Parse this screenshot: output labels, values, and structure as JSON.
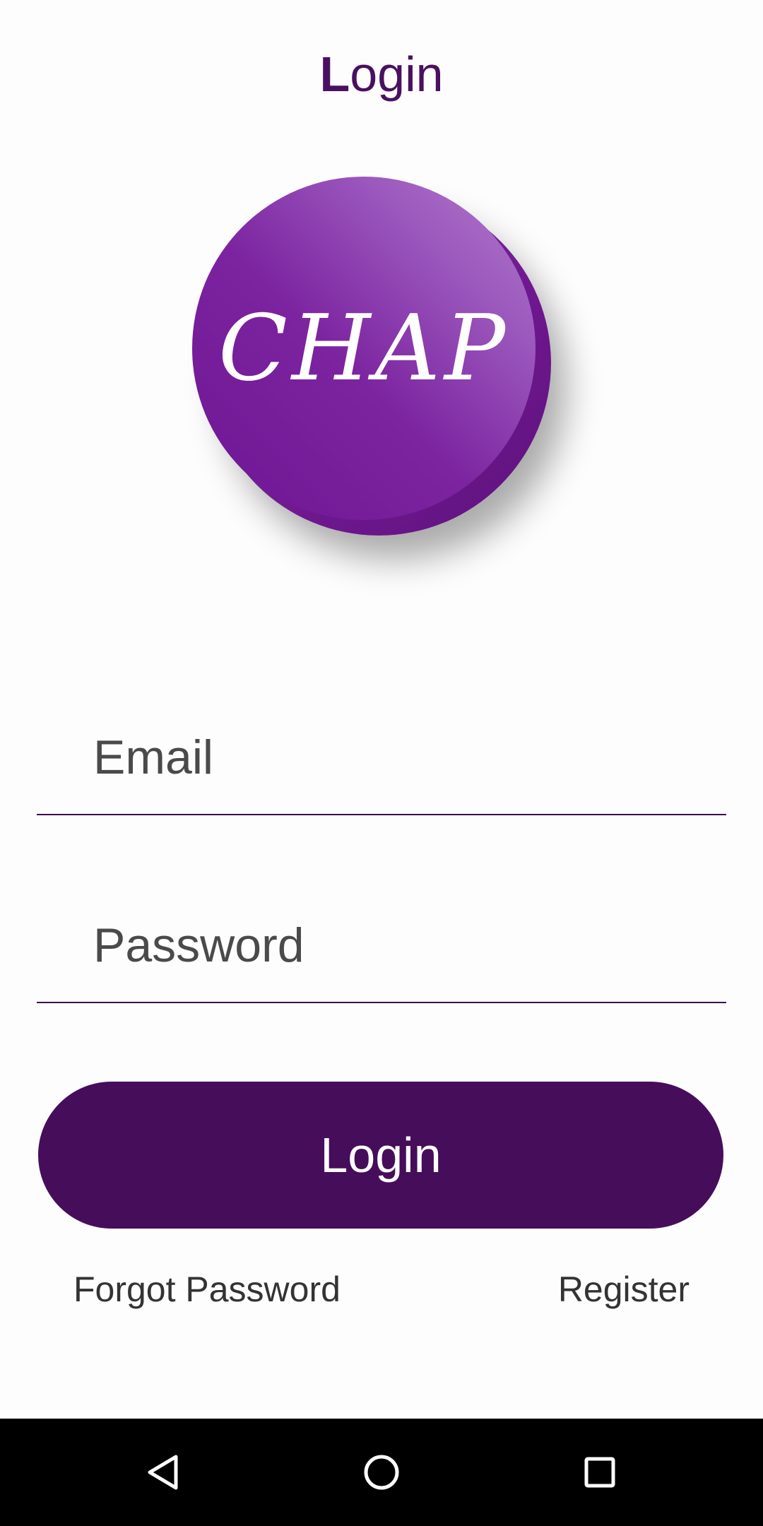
{
  "header": {
    "title_first_letter": "L",
    "title_rest": "ogin"
  },
  "logo": {
    "text": "CHAP"
  },
  "form": {
    "email_placeholder": "Email",
    "email_value": "",
    "password_placeholder": "Password",
    "password_value": "",
    "login_label": "Login"
  },
  "links": {
    "forgot_password": "Forgot Password",
    "register": "Register"
  },
  "navbar": {
    "back_icon": "back-triangle-icon",
    "home_icon": "home-circle-icon",
    "recents_icon": "recents-square-icon"
  },
  "colors": {
    "brand": "#460d5a",
    "logo_purple": "#7c24a0",
    "title": "#4a1060"
  }
}
